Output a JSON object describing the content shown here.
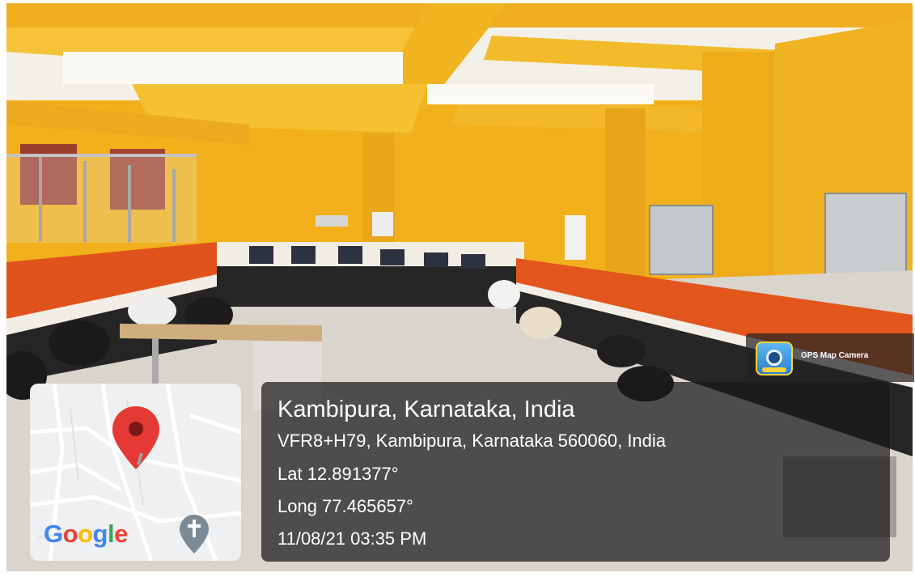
{
  "photo": {
    "scene": "office-room-with-computer-desks",
    "colors": {
      "wall": "#f2b31e",
      "partition": "#e2561e",
      "ceiling": "#f4f2ec",
      "floor": "#d9d4cc"
    }
  },
  "watermark": {
    "app_name": "GPS Map Camera",
    "icon": "gps-map-camera-icon"
  },
  "map": {
    "logo_text": "Google",
    "pin_icon": "location-pin-icon",
    "cross_icon": "church-cross-icon"
  },
  "location": {
    "title": "Kambipura, Karnataka, India",
    "address": "VFR8+H79, Kambipura, Karnataka 560060, India",
    "latitude": "Lat 12.891377°",
    "longitude": "Long 77.465657°",
    "timestamp": "11/08/21 03:35 PM"
  }
}
